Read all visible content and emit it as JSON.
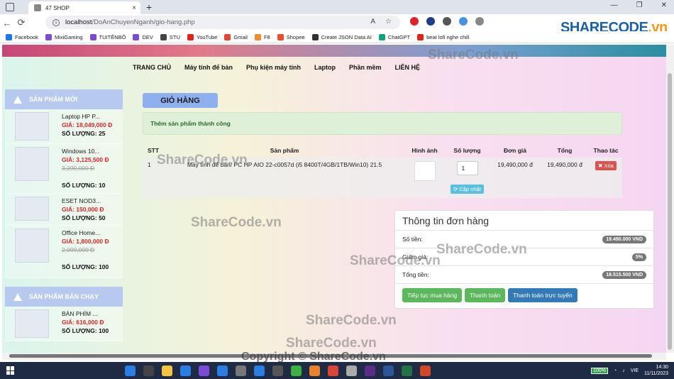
{
  "browser": {
    "tab_title": "47 SHOP",
    "url_host": "localhost",
    "url_path": "/DoAnChuyenNganh/gio-hang.php",
    "bookmarks": [
      "Facebook",
      "MixiGaming",
      "TUITÊNBÔ",
      "DEV",
      "STU",
      "YouTube",
      "Gmail",
      "F8",
      "Shopee",
      "Create JSON Data AI",
      "ChatGPT",
      "beat lofi nghe chill"
    ]
  },
  "nav": [
    "TRANG CHỦ",
    "Máy tính để bàn",
    "Phụ kiện máy tính",
    "Laptop",
    "Phần mềm",
    "LIÊN HỆ"
  ],
  "sidebar": {
    "new_title": "SẢN PHẨM MỚI",
    "best_title": "SẢN PHẨM BÁN CHẠY",
    "new_products": [
      {
        "name": "Laptop HP P...",
        "price": "GIÁ: 18,049,000 Đ",
        "old": "",
        "qty": "SỐ LƯỢNG: 25"
      },
      {
        "name": "Windows 10...",
        "price": "GIÁ: 3,125,500 Đ",
        "old": "3,290,000 Đ",
        "qty": "SỐ LƯỢNG: 10"
      },
      {
        "name": "ESET NOD3...",
        "price": "GIÁ: 150,000 Đ",
        "old": "",
        "qty": "SỐ LƯỢNG: 50"
      },
      {
        "name": "Office Home...",
        "price": "GIÁ: 1,800,000 Đ",
        "old": "2,000,000 Đ",
        "qty": "SỐ LƯỢNG: 100"
      }
    ],
    "best_products": [
      {
        "name": "BÀN PHÍM ...",
        "price": "GIÁ: 616,000 Đ",
        "qty": "SỐ LƯỢNG: 100"
      }
    ]
  },
  "cart": {
    "title": "GIỎ HÀNG",
    "alert": "Thêm sản phẩm thành công",
    "headers": [
      "STT",
      "Sản phẩm",
      "Hình ảnh",
      "Số lượng",
      "Đơn giá",
      "Tổng",
      "Thao tác"
    ],
    "rows": [
      {
        "stt": "1",
        "product": "Máy tính để bàn/ PC HP AIO 22-c0057d (i5 8400T/4GB/1TB/Win10) 21.5",
        "qty": "1",
        "unit_price": "19,490,000 đ",
        "total": "19,490,000 đ",
        "delete": "✖ Xóa",
        "update": "⟳ Cập nhật"
      }
    ]
  },
  "order": {
    "title": "Thông tin đơn hàng",
    "rows": [
      {
        "label": "Số tiền:",
        "value": "19.490.000 VND"
      },
      {
        "label": "Giảm giá:",
        "value": "5%"
      },
      {
        "label": "Tổng tiền:",
        "value": "18.515.500 VND"
      }
    ],
    "buttons": [
      "Tiếp tục mua hàng",
      "Thanh toán",
      "Thanh toán trực tuyến"
    ]
  },
  "taskbar": {
    "battery": "100%",
    "lang": "VIE",
    "time": "14:30",
    "date": "11/11/2023"
  },
  "watermarks": {
    "logo": "SHARECODE",
    "logo_suffix": ".vn",
    "site": "ShareCode.vn",
    "copyright": "Copyright © ShareCode.vn"
  }
}
